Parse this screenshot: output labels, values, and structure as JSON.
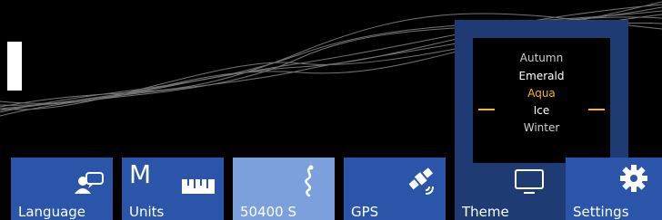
{
  "colors": {
    "tile": "#2b55a8",
    "tile_active": "#7ba0dc",
    "theme_panel": "#1e3c73",
    "accent": "#f5b81c"
  },
  "tiles": {
    "language": {
      "label": "Language",
      "icon": "speech-person-icon"
    },
    "units": {
      "label": "Units",
      "letter": "M",
      "icon": "ruler-icon"
    },
    "duration": {
      "label": "50400 S",
      "icon": "route-icon"
    },
    "gps": {
      "label": "GPS",
      "icon": "satellite-icon"
    },
    "theme": {
      "label": "Theme",
      "icon": "monitor-icon"
    },
    "settings": {
      "label": "Settings",
      "icon": "gear-icon"
    }
  },
  "theme_picker": {
    "options": [
      "Autumn",
      "Emerald",
      "Aqua",
      "Ice",
      "Winter"
    ],
    "selected": "Aqua"
  }
}
